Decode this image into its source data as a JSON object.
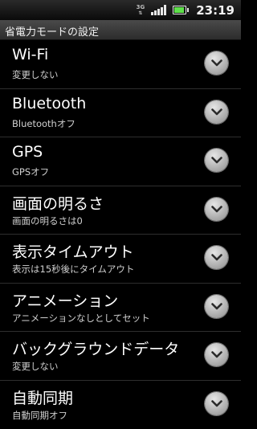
{
  "status_bar": {
    "network_type": "3G",
    "network_activity": "⇅",
    "signal_level": 0.8,
    "battery_level": 0.9,
    "icon_names": [
      "3g-icon",
      "signal-icon",
      "battery-icon"
    ],
    "time": "23:19"
  },
  "header": {
    "title": "省電力モードの設定"
  },
  "settings": [
    {
      "title": "Wi-Fi",
      "summary": "変更しない"
    },
    {
      "title": "Bluetooth",
      "summary": "Bluetoothオフ"
    },
    {
      "title": "GPS",
      "summary": "GPSオフ"
    },
    {
      "title": "画面の明るさ",
      "summary": "画面の明るさは0"
    },
    {
      "title": "表示タイムアウト",
      "summary": "表示は15秒後にタイムアウト"
    },
    {
      "title": "アニメーション",
      "summary": "アニメーションなしとしてセット"
    },
    {
      "title": "バックグラウンドデータ",
      "summary": "変更しない"
    },
    {
      "title": "自動同期",
      "summary": "自動同期オフ"
    }
  ],
  "colors": {
    "background": "#000000",
    "battery_fill": "#5ee04a",
    "divider": "#2e2e2e"
  }
}
